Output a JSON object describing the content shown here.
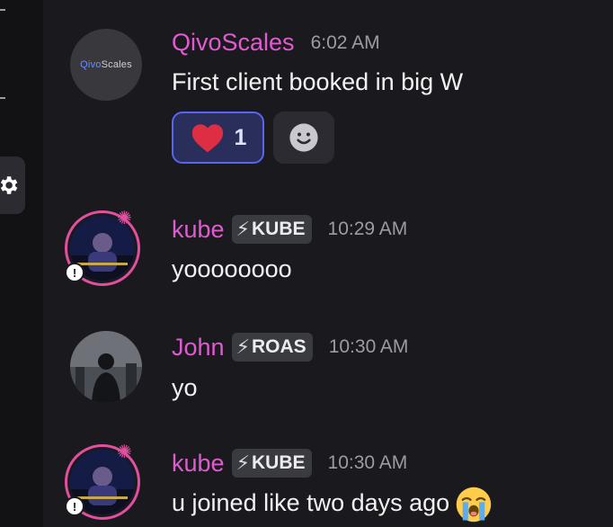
{
  "messages": [
    {
      "username": "QivoScales",
      "timestamp": "6:02 AM",
      "content": "First client booked in big W",
      "avatar_text_a": "Qivo",
      "avatar_text_b": "Scales",
      "reactions": [
        {
          "emoji": "heart",
          "count": "1"
        },
        {
          "emoji": "add-reaction"
        }
      ]
    },
    {
      "username": "kube",
      "tag": "KUBE",
      "timestamp": "10:29 AM",
      "content": "yoooooooo"
    },
    {
      "username": "John",
      "tag": "ROAS",
      "timestamp": "10:30 AM",
      "content": "yo"
    },
    {
      "username": "kube",
      "tag": "KUBE",
      "timestamp": "10:30 AM",
      "content": "u joined like two days ago",
      "trailing_emoji": "loudly-crying-face"
    }
  ],
  "colors": {
    "username": "#e15bd0",
    "timestamp": "#9b9ba3",
    "reaction_active_border": "#5865f2",
    "background": "#1a1a1e"
  },
  "icons": {
    "settings": "gear-icon",
    "tag": "lightning-icon",
    "add_reaction": "smiley-icon"
  }
}
